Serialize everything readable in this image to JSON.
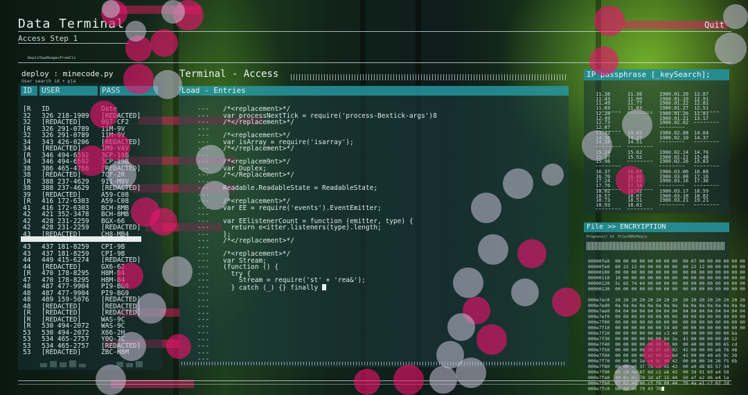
{
  "header": {
    "title": "Data Terminal",
    "subtitle": "Access Step 1",
    "quit_label": "Quit",
    "tiny_path": "DeploYpaKkagesFromCli"
  },
  "left_panel": {
    "title": "deploy : minecode.py",
    "subtitle": "User search id + p|a",
    "columns": [
      "ID",
      "USER",
      "PASS"
    ],
    "rows_top": [
      [
        "[R",
        "ID",
        "Date"
      ],
      [
        "32",
        "326 218-1909",
        "[REDACTED]"
      ],
      [
        "32",
        "[REDACTED]",
        "0Q7-CF2"
      ],
      [
        "[R",
        "326 291-0789",
        "11M-9V"
      ],
      [
        "32",
        "326 291-0789",
        "11M-9V"
      ],
      [
        "34",
        "343 426-0206",
        "[REDACTED]"
      ],
      [
        "34",
        "[REDACTED]",
        "1M9-VAV"
      ],
      [
        "[R",
        "346 494-6592",
        "3CP-19B"
      ],
      [
        "34",
        "346 494-6592",
        "3CP-19B"
      ],
      [
        "38",
        "386 465-4768",
        "[REDACTED]"
      ],
      [
        "38",
        "[REDACTED]",
        "7CF-2R"
      ],
      [
        "[R",
        "388 237-4629",
        "911-M9V"
      ],
      [
        "38",
        "388 237-4629",
        "[REDACTED]"
      ],
      [
        "39",
        "[REDACTED]",
        "A59-C08"
      ],
      [
        "[R",
        "416 172-6303",
        "A59-C08"
      ],
      [
        "41",
        "416 172-6303",
        "BCH-8MB"
      ],
      [
        "42",
        "421 352-3478",
        "BCH-8MB"
      ],
      [
        "42",
        "428 231-2259",
        "BGX-66"
      ],
      [
        "42",
        "428 231-2259",
        "[REDACTED]"
      ],
      [
        "43",
        "[REDACTED]",
        "CH8-MB4"
      ]
    ],
    "rows_bottom": [
      [
        "43",
        "437 181-8259",
        "CPI-9B"
      ],
      [
        "43",
        "437 181-8259",
        "CPI-9B"
      ],
      [
        "44",
        "449 415-6274",
        "[REDACTED]"
      ],
      [
        "44",
        "[REDACTED]",
        "GX6-62"
      ],
      [
        "[R",
        "470 178-8295",
        "H8M-B4"
      ],
      [
        "47",
        "470 178-8295",
        "H8M-B4"
      ],
      [
        "48",
        "487 477-9904",
        "PI9-BG9"
      ],
      [
        "48",
        "487 477-9904",
        "PI9-BG9"
      ],
      [
        "48",
        "489 159-5076",
        "[REDACTED]"
      ],
      [
        "48",
        "[REDACTED]",
        "[REDACTED]"
      ],
      [
        "[R",
        "[REDACTED]",
        "[REDACTED]"
      ],
      [
        "[R",
        "[REDACTED]",
        "WAS-9C"
      ],
      [
        "[R",
        "530 494-2072",
        "WAS-9C"
      ],
      [
        "53",
        "530 494-2072",
        "X66-2H"
      ],
      [
        "53",
        "534 465-2757",
        "Y0Q-7C"
      ],
      [
        "53",
        "534 465-2757",
        "[REDACTED]"
      ],
      [
        "53",
        "[REDACTED]",
        "ZBC-H8M"
      ]
    ]
  },
  "terminal": {
    "title": "Terminal - Access",
    "bar_label": "Load - Entries",
    "line_marker": "---",
    "lines": [
      "/*<replacement>*/",
      "var processNextTick = require('process-Bextick-args')8",
      "/*</replacement>*/",
      "",
      "/*<replacement>*/",
      "var isArray = require('isarray');",
      "/*</replacement>*/",
      "",
      "/*<replacem9nt>*/",
      "var Duplex;",
      "/*</Replacement>*/",
      "",
      "Readable.ReadableState = ReadableState;",
      "",
      "/*<replacement>*/",
      "var EE = require('events').EventEmitter;",
      "",
      "var EElistenerCount = function (emitter, type) {",
      "  return e<itter.listeners(type).length;",
      "};",
      "/*</replacement>*/",
      "",
      "/*<replacement>*/",
      "var Stream;",
      "(function () {",
      "  try {",
      "    Stream = require('st' + 'rea&');",
      "  } catch (_) {} finally "
    ]
  },
  "ip_panel": {
    "title": "IP passphrase [_keySearch];",
    "blocks": [
      [
        "11.38",
        "11.43",
        "11.49",
        "11.83"
      ],
      [
        "11.38",
        "11.60",
        "11.77",
        "11.83"
      ],
      [
        "1980.01.20",
        "1980.01.10",
        "1980.01.22",
        "1980.01.27"
      ],
      [
        "12.87",
        "12.91",
        "12.81",
        "12.51"
      ],
      [
        "12.28",
        "12.49",
        "12.73",
        "12.87"
      ],
      [
        "",
        "",
        "",
        ""
      ],
      [
        "1980.01.26",
        "1980.01.21",
        "",
        "1980.02.02"
      ],
      [
        "12.81",
        "13.17",
        "",
        ""
      ],
      [
        "13.42",
        "14.38",
        "14.28",
        ""
      ],
      [
        "14.03",
        "14.27",
        "14.51",
        ""
      ],
      [
        "1980.02.08",
        "1980.02.10",
        "",
        ""
      ],
      [
        "14.04",
        "14.37",
        "",
        ""
      ],
      [
        "15.24",
        "15.37",
        "15.98",
        ""
      ],
      [
        "15.62",
        "15.52",
        "",
        ""
      ],
      [
        "1980.02.14",
        "1980.02.21",
        "1980.02.26",
        ""
      ],
      [
        "14.76",
        "15.48",
        "15.83",
        ""
      ],
      [
        "16.37",
        "16.70",
        "17.24",
        "17.76"
      ],
      [
        "16.87",
        "16.88",
        "17.02",
        "17.34"
      ],
      [
        "1980.03.06",
        "1980.03.08",
        "1980.03.16",
        ""
      ],
      [
        "16.88",
        "17.16",
        "17.36",
        ""
      ],
      [
        "18.02",
        "18.57",
        "18.73",
        "18.93"
      ],
      [
        "18.02",
        "18.07",
        "18.51",
        "18.61"
      ],
      [
        "1980.03.17",
        "1980.03.18",
        "1980.03.21",
        ""
      ],
      [
        "18.59",
        "18.82",
        "",
        "19.21"
      ]
    ]
  },
  "encrypt_panel": {
    "title": "File >> ENCRYIPTION",
    "subtitle": "Progress// ld  File/ROO/Key/y",
    "hex_lines": [
      "00000fe0  00 00 00 00 00 00 00 00  00 07 00 00 00 00 00 00",
      "00000fe0  60 22 12 00 00 00 00 00  60 22 12 00 00 00 00 00",
      "00000100  00 00 00 00 00 00 00 00  00 00 00 00 00 00 00 00",
      "00000110  10 00 00 00 00 00 00 00  00 00 00 00 00 00 00 00",
      "00000120  5c 65 74 64 00 00 00 00  00 00 00 00 00 00 00 00",
      "00000130  00 00 00 00 00 00 00 00  00 00 00 00 00 00 00 00",
      "",
      "000e7ec0  20 20 20 20 20 20 20 20  20 20 20 20 20 20 20 20",
      "000e7ed0  0a 0a 0a 0a 0a 0a 0a 0a  0a 0a 0a 0a 0a 0a 0a 0a",
      "000e7ee0  04 04 04 04 04 04 04 04  04 04 04 04 04 04 04 04",
      "000e7ef0  09 09 09 09 09 09 09 09  09 09 09 09 09 09 09 09",
      "000e7f00  00 00 00 00 00 00 00 00  00 00 00 00 00 00 00 00",
      "000e7f10  00 00 00 00 00 00 59 40  00 00 00 00 00 00 00 00",
      "000e7f20  00 00 00 00 00 88 c3 40  00 00 00 00 00 00 6a",
      "000e7f30  00 00 00 00 00 80 84 2e  41 00 00 00 00 d0 12",
      "000e7f40  00 00 00 00 00 00 00 00  00 40 00 00 00 65 cd",
      "000e7f50  00 00 00 00 20 5f a0 02  42 00 00 00 e8 76 48",
      "000e7f60  00 00 00 00 a2 94 1a 6d  42 00 00 40 e5 9c 30",
      "000e7f70  00 00 90 1e c4 bc d6 42  00 00 00 34 26 f5 6b",
      "000e7f80  00 80 e0 37 79 c3 41 43  00 a0 d8 85 57 34",
      "000e7f90  00 c8 4e 67 6d c1 ab 43  00 3d 91 60 e4 58",
      "000e7fa0  40 8c b5 78 1d af 15 44  50 ef e2 d6 e4 1a",
      "000e7fb0  8f 02 4d 06 cf f0 80 44  f6 4a e1 c7 02 2d",
      "000e7fc0  b6 9d d0 79 43 78"
    ]
  }
}
